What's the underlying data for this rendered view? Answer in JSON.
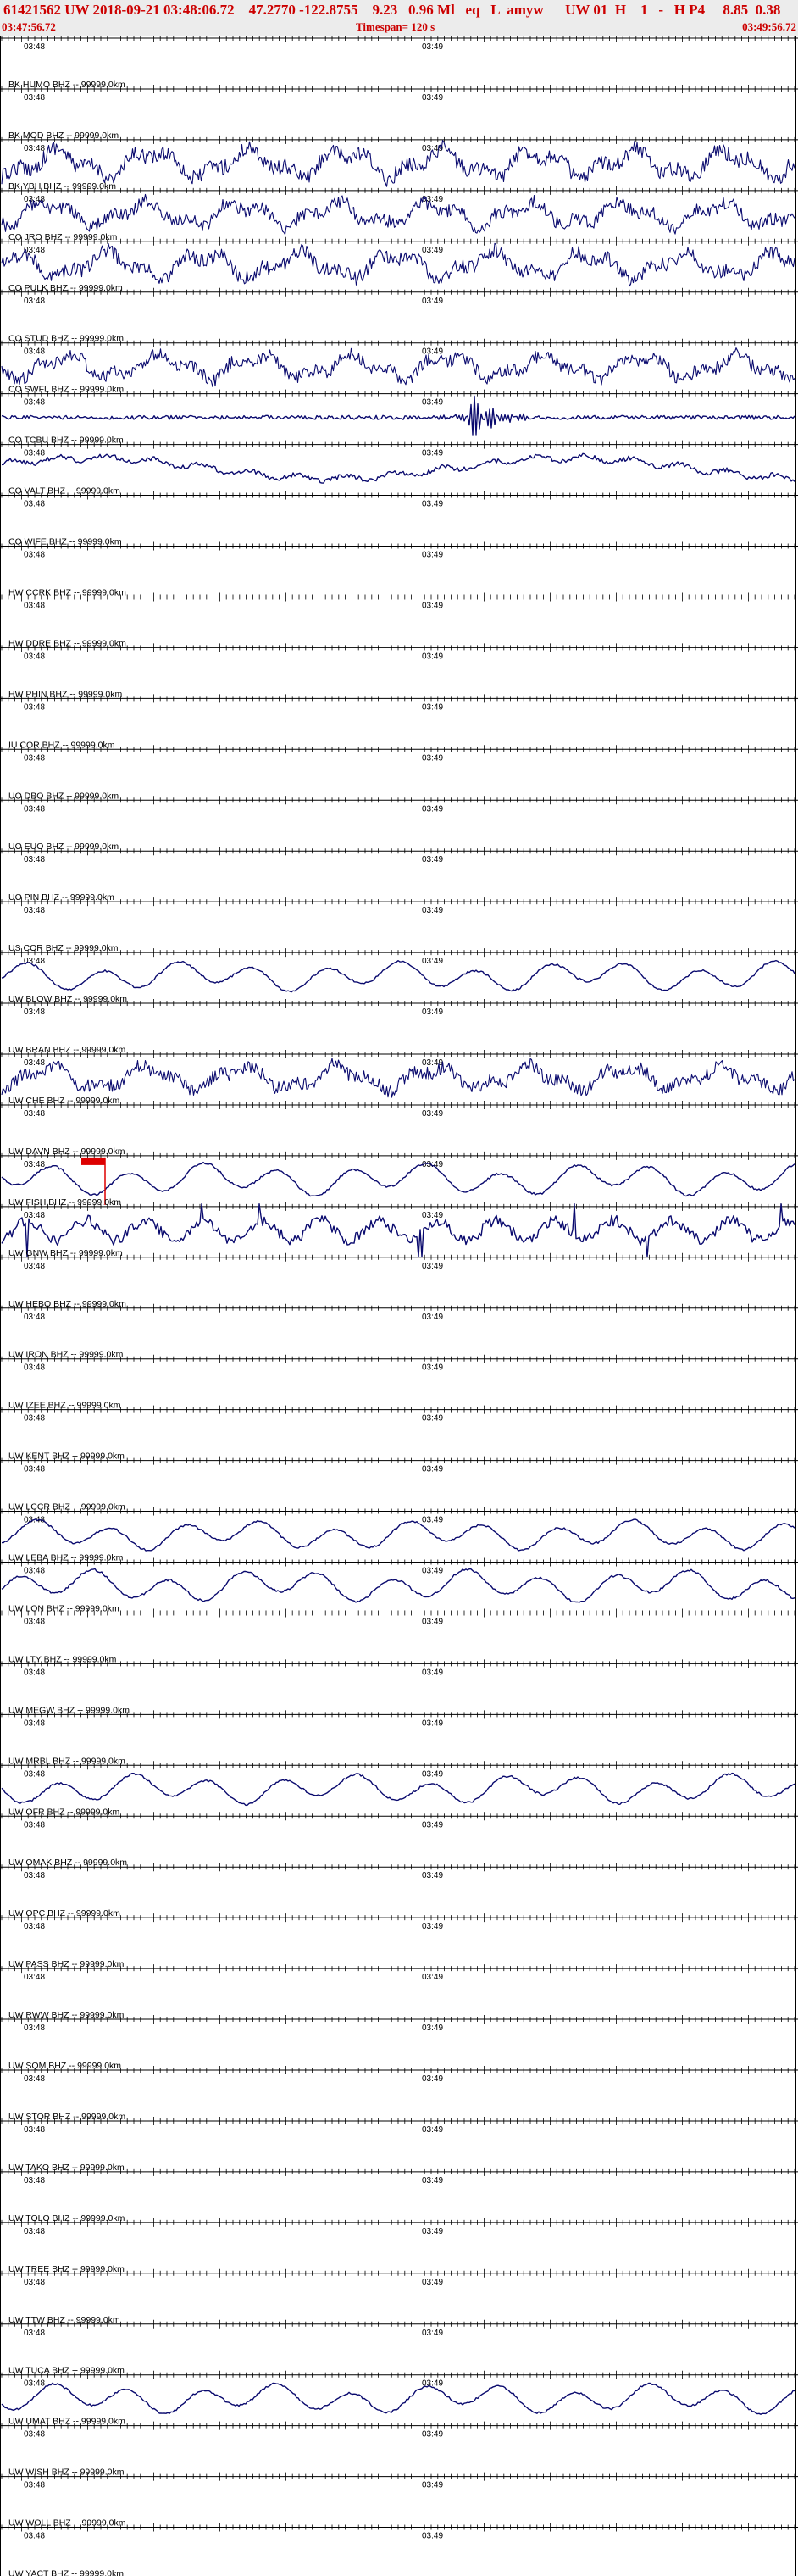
{
  "header": {
    "line1": "61421562 UW 2018-09-21 03:48:06.72    47.2770 -122.8755    9.23   0.96 Ml   eq   L  amyw      UW 01  H    1   -   H P4     8.85  0.38",
    "start_time": "03:47:56.72",
    "timespan": "Timespan= 120 s",
    "end_time": "03:49:56.72"
  },
  "colors": {
    "header_text": "#cc0000",
    "trace": "#0a0a6e",
    "axis": "#000000",
    "pick": "#dd0000",
    "header_bg": "#ececec"
  },
  "tick_labels": {
    "left": "03:48",
    "mid": "03:49"
  },
  "channels": [
    {
      "label": "BK HUMO BHZ -- 99999.0km",
      "amp": 0
    },
    {
      "label": "BK MOD BHZ -- 99999.0km",
      "amp": 0
    },
    {
      "label": "BK YBH BHZ -- 99999.0km",
      "amp": 26,
      "style": "noisy"
    },
    {
      "label": "CQ JRO BHZ -- 99999.0km",
      "amp": 22,
      "style": "noisy"
    },
    {
      "label": "CQ PULK BHZ -- 99999.0km",
      "amp": 24,
      "style": "noisy"
    },
    {
      "label": "CQ STUD BHZ -- 99999.0km",
      "amp": 0
    },
    {
      "label": "CQ SWFL BHZ -- 99999.0km",
      "amp": 22,
      "style": "noisy"
    },
    {
      "label": "CQ TCBU BHZ -- 99999.0km",
      "amp": 6,
      "style": "event"
    },
    {
      "label": "CQ VALT BHZ -- 99999.0km",
      "amp": 22,
      "style": "drift"
    },
    {
      "label": "CQ WIFE BHZ -- 99999.0km",
      "amp": 0
    },
    {
      "label": "HW CCRK BHZ -- 99999.0km",
      "amp": 0
    },
    {
      "label": "HW DDRE BHZ -- 99999.0km",
      "amp": 0
    },
    {
      "label": "HW PHIN BHZ -- 99999.0km",
      "amp": 0
    },
    {
      "label": "IU COR BHZ -- 99999.0km",
      "amp": 0
    },
    {
      "label": "UO DBO BHZ -- 99999.0km",
      "amp": 0
    },
    {
      "label": "UO EUO BHZ -- 99999.0km",
      "amp": 0
    },
    {
      "label": "UO PIN BHZ -- 99999.0km",
      "amp": 0
    },
    {
      "label": "US COR BHZ -- 99999.0km",
      "amp": 0
    },
    {
      "label": "UW BLOW BHZ -- 99999.0km",
      "amp": 20,
      "style": "smooth"
    },
    {
      "label": "UW BRAN BHZ -- 99999.0km",
      "amp": 0
    },
    {
      "label": "UW CHE BHZ -- 99999.0km",
      "amp": 22,
      "style": "noisy"
    },
    {
      "label": "UW DAVN BHZ -- 99999.0km",
      "amp": 0
    },
    {
      "label": "UW FISH BHZ -- 99999.0km",
      "amp": 22,
      "style": "smooth",
      "pick": true
    },
    {
      "label": "UW GNW BHZ -- 99999.0km",
      "amp": 26,
      "style": "spiky"
    },
    {
      "label": "UW HEBO BHZ -- 99999.0km",
      "amp": 0
    },
    {
      "label": "UW IRON BHZ -- 99999.0km",
      "amp": 0
    },
    {
      "label": "UW IZEE BHZ -- 99999.0km",
      "amp": 0
    },
    {
      "label": "UW KENT BHZ -- 99999.0km",
      "amp": 0
    },
    {
      "label": "UW LCCR BHZ -- 99999.0km",
      "amp": 0
    },
    {
      "label": "UW LEBA BHZ -- 99999.0km",
      "amp": 20,
      "style": "smooth"
    },
    {
      "label": "UW LON BHZ -- 99999.0km",
      "amp": 22,
      "style": "smooth"
    },
    {
      "label": "UW LTY BHZ -- 99999.0km",
      "amp": 0
    },
    {
      "label": "UW MEGW BHZ -- 99999.0km",
      "amp": 0
    },
    {
      "label": "UW MRBL BHZ -- 99999.0km",
      "amp": 0
    },
    {
      "label": "UW OFR BHZ -- 99999.0km",
      "amp": 20,
      "style": "smooth"
    },
    {
      "label": "UW OMAK BHZ -- 99999.0km",
      "amp": 0
    },
    {
      "label": "UW OPC BHZ -- 99999.0km",
      "amp": 0
    },
    {
      "label": "UW PASS BHZ -- 99999.0km",
      "amp": 0
    },
    {
      "label": "UW RWW BHZ -- 99999.0km",
      "amp": 0
    },
    {
      "label": "UW SQM BHZ -- 99999.0km",
      "amp": 0
    },
    {
      "label": "UW STOR BHZ -- 99999.0km",
      "amp": 0
    },
    {
      "label": "UW TAKO BHZ -- 99999.0km",
      "amp": 0
    },
    {
      "label": "UW TOLO BHZ -- 99999.0km",
      "amp": 0
    },
    {
      "label": "UW TREE BHZ -- 99999.0km",
      "amp": 0
    },
    {
      "label": "UW TTW BHZ -- 99999.0km",
      "amp": 0
    },
    {
      "label": "UW TUCA BHZ -- 99999.0km",
      "amp": 0
    },
    {
      "label": "UW UMAT BHZ -- 99999.0km",
      "amp": 20,
      "style": "smooth"
    },
    {
      "label": "UW WISH BHZ -- 99999.0km",
      "amp": 0
    },
    {
      "label": "UW WOLL BHZ -- 99999.0km",
      "amp": 0
    },
    {
      "label": "UW YACT BHZ -- 99999.0km",
      "amp": 0
    }
  ]
}
